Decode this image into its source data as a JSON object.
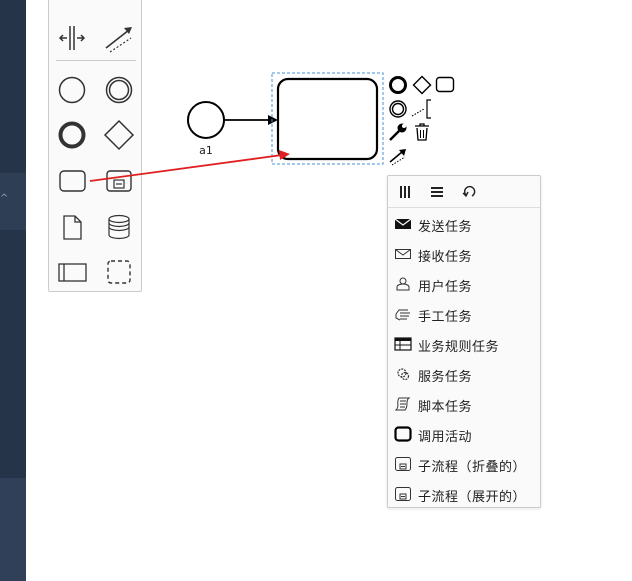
{
  "canvas": {
    "start_event_label": "a1"
  },
  "palette": {
    "tools": [
      {
        "name": "create-expanded-pool"
      },
      {
        "name": "lasso-tool"
      },
      {
        "name": "space-tool"
      },
      {
        "name": "global-connect-tool"
      },
      {
        "name": "create-start-event"
      },
      {
        "name": "create-intermediate-event"
      },
      {
        "name": "create-end-event"
      },
      {
        "name": "create-gateway"
      },
      {
        "name": "create-task"
      },
      {
        "name": "create-subprocess"
      },
      {
        "name": "create-data-object"
      },
      {
        "name": "create-data-store"
      },
      {
        "name": "create-participant"
      },
      {
        "name": "create-group"
      }
    ]
  },
  "context_pad": {
    "items": [
      "end-event-icon",
      "gateway-icon",
      "task-icon",
      "intermediate-event-icon",
      "text-annotation-icon",
      "wrench-icon",
      "trash-icon",
      "connect-icon"
    ]
  },
  "popup": {
    "header_icons": [
      "parallel-multi-instance-icon",
      "sequential-multi-instance-icon",
      "loop-icon"
    ],
    "entries": [
      {
        "label": "发送任务",
        "icon": "send-task-icon"
      },
      {
        "label": "接收任务",
        "icon": "receive-task-icon"
      },
      {
        "label": "用户任务",
        "icon": "user-task-icon"
      },
      {
        "label": "手工任务",
        "icon": "manual-task-icon"
      },
      {
        "label": "业务规则任务",
        "icon": "business-rule-task-icon"
      },
      {
        "label": "服务任务",
        "icon": "service-task-icon"
      },
      {
        "label": "脚本任务",
        "icon": "script-task-icon"
      },
      {
        "label": "调用活动",
        "icon": "call-activity-icon"
      },
      {
        "label": "子流程（折叠的）",
        "icon": "collapsed-subprocess-icon"
      },
      {
        "label": "子流程（展开的）",
        "icon": "expanded-subprocess-icon"
      }
    ]
  },
  "colors": {
    "sidebar": "#253448",
    "annotation_arrow": "#e02020",
    "selection": "#4a90d9"
  }
}
